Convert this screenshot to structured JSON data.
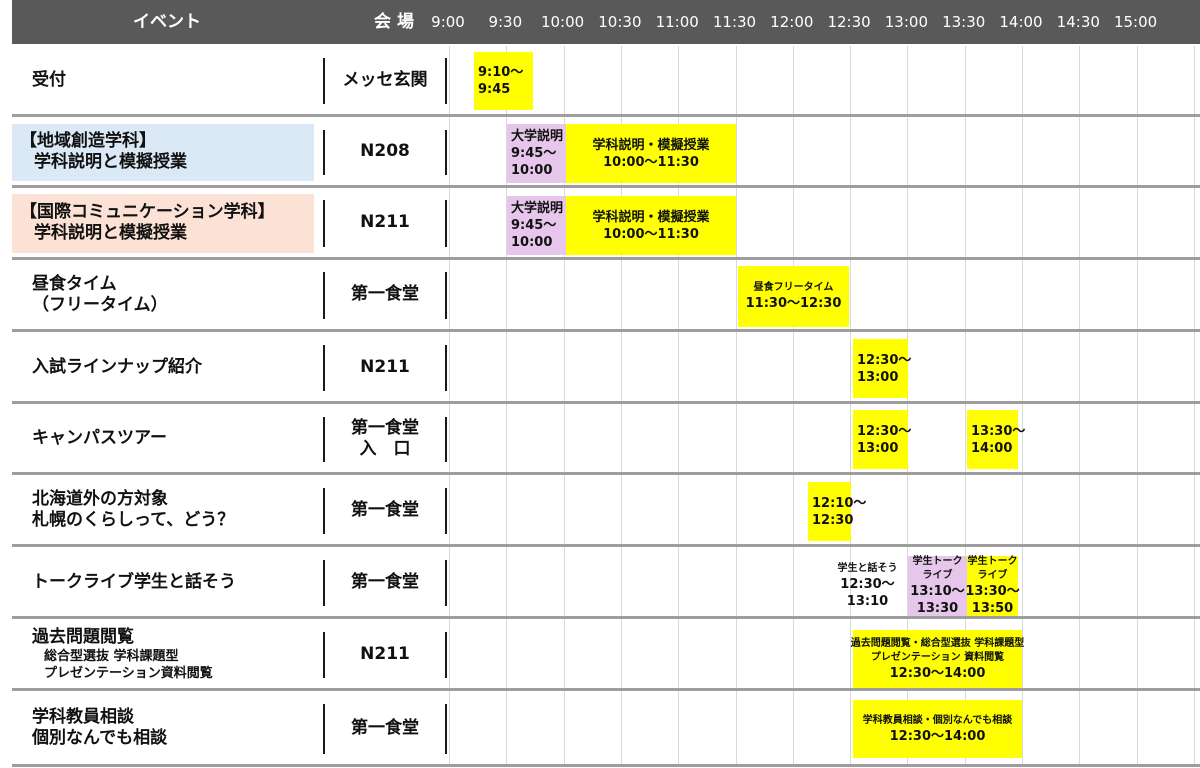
{
  "header": {
    "event_label": "イベント",
    "venue_label": "会場",
    "times": [
      "9:00",
      "9:30",
      "10:00",
      "10:30",
      "11:00",
      "11:30",
      "12:00",
      "12:30",
      "13:00",
      "13:30",
      "14:00",
      "14:30",
      "15:00"
    ]
  },
  "colors": {
    "header_bg": "#595959",
    "block_yellow": "#ffff00",
    "block_pink": "#e6c6ea",
    "dept_blue": "#dbe8f5",
    "dept_peach": "#fbe2d5"
  },
  "rows": [
    {
      "event": [
        "受付"
      ],
      "venue": [
        "メッセ玄関"
      ],
      "blocks": [
        {
          "lines": [
            "9:10〜",
            "9:45"
          ]
        }
      ]
    },
    {
      "event": [
        "【地域創造学科】",
        "学科説明と模擬授業"
      ],
      "venue": [
        "N208"
      ],
      "blocks": [
        {
          "lines": [
            "大学説明",
            "9:45〜",
            "10:00"
          ]
        },
        {
          "lines": [
            "学科説明・模擬授業",
            "10:00〜11:30"
          ]
        }
      ]
    },
    {
      "event": [
        "【国際コミュニケーション学科】",
        "学科説明と模擬授業"
      ],
      "venue": [
        "N211"
      ],
      "blocks": [
        {
          "lines": [
            "大学説明",
            "9:45〜",
            "10:00"
          ]
        },
        {
          "lines": [
            "学科説明・模擬授業",
            "10:00〜11:30"
          ]
        }
      ]
    },
    {
      "event": [
        "昼食タイム",
        "（フリータイム）"
      ],
      "venue": [
        "第一食堂"
      ],
      "blocks": [
        {
          "lines": [
            "昼食フリータイム",
            "11:30〜12:30"
          ]
        }
      ]
    },
    {
      "event": [
        "入試ラインナップ紹介"
      ],
      "venue": [
        "N211"
      ],
      "blocks": [
        {
          "lines": [
            "12:30〜",
            "13:00"
          ]
        }
      ]
    },
    {
      "event": [
        "キャンパスツアー"
      ],
      "venue": [
        "第一食堂",
        "入　口"
      ],
      "blocks": [
        {
          "lines": [
            "12:30〜",
            "13:00"
          ]
        },
        {
          "lines": [
            "13:30〜",
            "14:00"
          ]
        }
      ]
    },
    {
      "event": [
        "北海道外の方対象",
        "札幌のくらしって、どう？"
      ],
      "venue": [
        "第一食堂"
      ],
      "blocks": [
        {
          "lines": [
            "12:10〜",
            "12:30"
          ]
        }
      ]
    },
    {
      "event": [
        "トークライブ学生と話そう"
      ],
      "venue": [
        "第一食堂"
      ],
      "blocks": [
        {
          "lines": [
            "学生と話そう",
            "12:30〜",
            "13:10"
          ]
        },
        {
          "lines": [
            "学生トーク",
            "ライブ",
            "13:10〜",
            "13:30"
          ]
        },
        {
          "lines": [
            "学生トーク",
            "ライブ",
            "13:30〜",
            "13:50"
          ]
        }
      ]
    },
    {
      "event": [
        "過去問題閲覧",
        "総合型選抜 学科課題型",
        "プレゼンテーション資料閲覧"
      ],
      "venue": [
        "N211"
      ],
      "blocks": [
        {
          "lines": [
            "過去問題閲覧・総合型選抜 学科課題型",
            "プレゼンテーション 資料閲覧",
            "12:30〜14:00"
          ]
        }
      ]
    },
    {
      "event": [
        "学科教員相談",
        "個別なんでも相談"
      ],
      "venue": [
        "第一食堂"
      ],
      "blocks": [
        {
          "lines": [
            "学科教員相談・個別なんでも相談",
            "12:30〜14:00"
          ]
        }
      ]
    }
  ]
}
